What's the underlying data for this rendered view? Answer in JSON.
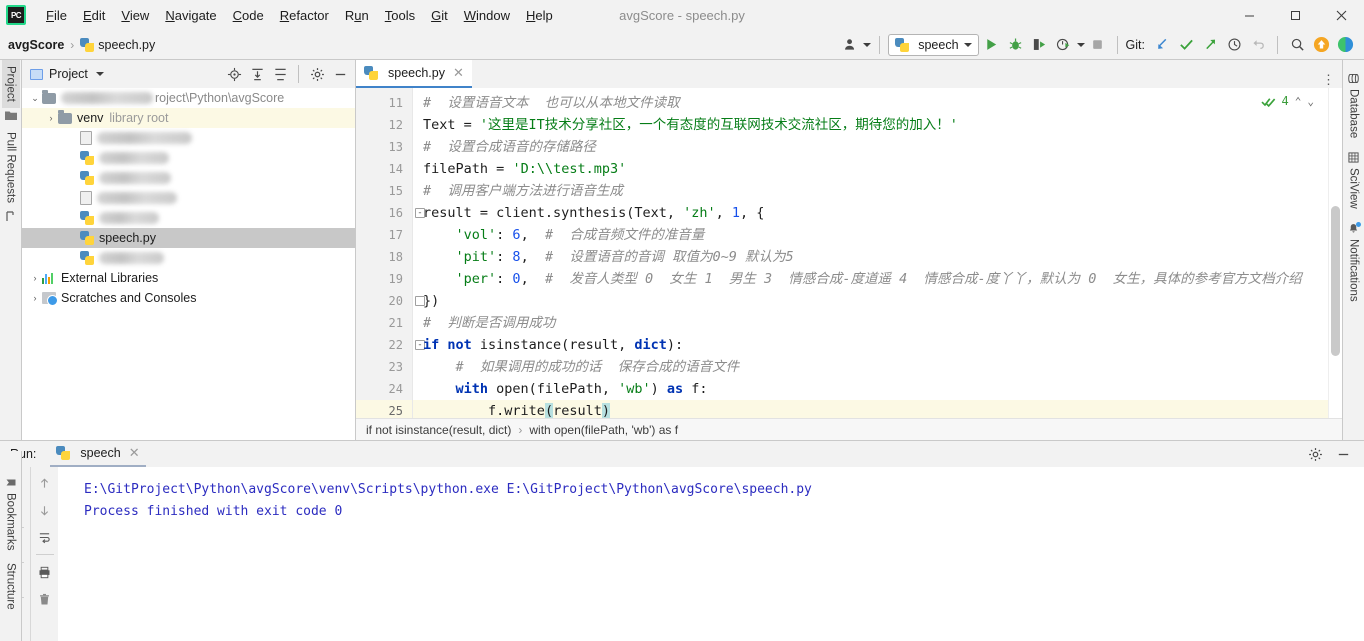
{
  "window": {
    "title": "avgScore - speech.py",
    "logo_text": "PC",
    "minimize": "—",
    "maximize": "❐",
    "close": "✕"
  },
  "menu": [
    {
      "label": "File",
      "mnemonic": "F"
    },
    {
      "label": "Edit",
      "mnemonic": "E"
    },
    {
      "label": "View",
      "mnemonic": "V"
    },
    {
      "label": "Navigate",
      "mnemonic": "N"
    },
    {
      "label": "Code",
      "mnemonic": "C"
    },
    {
      "label": "Refactor",
      "mnemonic": "R"
    },
    {
      "label": "Run",
      "mnemonic": "u"
    },
    {
      "label": "Tools",
      "mnemonic": "T"
    },
    {
      "label": "Git",
      "mnemonic": "G"
    },
    {
      "label": "Window",
      "mnemonic": "W"
    },
    {
      "label": "Help",
      "mnemonic": "H"
    }
  ],
  "navbar": {
    "project": "avgScore",
    "separator": "›",
    "file": "speech.py",
    "run_config": "speech",
    "git_label": "Git:",
    "icons": {
      "user_avatar": "user-avatar-icon",
      "run": "run-icon",
      "debug": "debug-icon",
      "coverage": "run-with-coverage-icon",
      "profile": "profile-icon",
      "stop": "stop-icon",
      "update_project": "update-project-icon",
      "commit": "commit-icon",
      "push": "push-icon",
      "history": "history-icon",
      "rollback": "rollback-icon",
      "search_everywhere": "search-icon",
      "notification_badge": "update-badge-icon",
      "ide_feature": "ide-feature-icon"
    }
  },
  "left_strip": [
    {
      "label": "Project",
      "selected": true
    },
    {
      "label": "Pull Requests",
      "selected": false
    }
  ],
  "left_strip_bottom": [
    {
      "label": "Bookmarks"
    },
    {
      "label": "Structure"
    }
  ],
  "right_strip": [
    {
      "label": "Database",
      "icon": "database-icon"
    },
    {
      "label": "SciView",
      "icon": "sciview-icon"
    },
    {
      "label": "Notifications",
      "icon": "notifications-icon"
    }
  ],
  "project_pane": {
    "title": "Project",
    "toolbar": [
      "locate-icon",
      "expand-all-icon",
      "collapse-all-icon",
      "settings-icon",
      "hide-icon"
    ],
    "tree": [
      {
        "kind": "root",
        "arrow": "⌄",
        "label_blurred": true,
        "path_suffix": "roject\\Python\\avgScore",
        "indent": 0,
        "selected": "none"
      },
      {
        "kind": "folder",
        "arrow": "›",
        "label": "venv",
        "tag": "library root",
        "indent": 1,
        "selected": "yellow"
      },
      {
        "kind": "doc",
        "label_blurred": true,
        "blur_width": 95,
        "indent": 2,
        "selected": "none"
      },
      {
        "kind": "py",
        "label_blurred": true,
        "blur_width": 70,
        "indent": 2,
        "selected": "none"
      },
      {
        "kind": "py",
        "label_blurred": true,
        "blur_width": 72,
        "indent": 2,
        "selected": "none"
      },
      {
        "kind": "doc",
        "label_blurred": true,
        "blur_width": 80,
        "indent": 2,
        "selected": "none"
      },
      {
        "kind": "py",
        "label_blurred": true,
        "blur_width": 60,
        "indent": 2,
        "selected": "none"
      },
      {
        "kind": "py",
        "label": "speech.py",
        "indent": 2,
        "selected": "grey"
      },
      {
        "kind": "py",
        "label_blurred": true,
        "blur_width": 65,
        "indent": 2,
        "selected": "none"
      },
      {
        "kind": "extlib",
        "arrow": "›",
        "label": "External Libraries",
        "indent": 0,
        "selected": "none"
      },
      {
        "kind": "scratch",
        "arrow": "›",
        "label": "Scratches and Consoles",
        "indent": 0,
        "selected": "none"
      }
    ]
  },
  "editor": {
    "tab": {
      "label": "speech.py",
      "close": "✕"
    },
    "options_glyph": "⋮",
    "inspection": {
      "count": "4",
      "icon": "inspection-ok-icon",
      "up": "⌃",
      "down": "⌄"
    },
    "first_line_number": 11,
    "current_line": 25,
    "lines": [
      {
        "n": 11,
        "fold": null
      },
      {
        "n": 12,
        "fold": null
      },
      {
        "n": 13,
        "fold": null
      },
      {
        "n": 14,
        "fold": null
      },
      {
        "n": 15,
        "fold": null
      },
      {
        "n": 16,
        "fold": "minus"
      },
      {
        "n": 17,
        "fold": null
      },
      {
        "n": 18,
        "fold": null
      },
      {
        "n": 19,
        "fold": null
      },
      {
        "n": 20,
        "fold": "end"
      },
      {
        "n": 21,
        "fold": null
      },
      {
        "n": 22,
        "fold": "minus"
      },
      {
        "n": 23,
        "fold": null
      },
      {
        "n": 24,
        "fold": null
      },
      {
        "n": 25,
        "fold": "end"
      }
    ],
    "code_text": [
      "#  设置语音文本  也可以从本地文件读取",
      "Text = '这里是IT技术分享社区，一个有态度的互联网技术交流社区，期待您的加入！'",
      "#  设置合成语音的存储路径",
      "filePath = 'D:\\\\test.mp3'",
      "#  调用客户端方法进行语音生成",
      "result = client.synthesis(Text, 'zh', 1, {",
      "    'vol': 6,  #  合成音频文件的准音量",
      "    'pit': 8,  #  设置语音的音调 取值为0~9 默认为5",
      "    'per': 0,  #  发音人类型 0  女生 1  男生 3  情感合成-度道遥 4  情感合成-度丫丫，默认为 0  女生，具体的参考官方文档介绍",
      "})",
      "#  判断是否调用成功",
      "if not isinstance(result, dict):",
      "    #  如果调用的成功的话  保存合成的语音文件",
      "    with open(filePath, 'wb') as f:",
      "        f.write(result)"
    ]
  },
  "breadcrumbs": {
    "item1": "if not isinstance(result, dict)",
    "separator": "›",
    "item2": "with open(filePath, 'wb') as f"
  },
  "run_panel": {
    "label": "Run:",
    "tab": "speech",
    "tab_close": "✕",
    "settings_icon": "settings-icon",
    "hide_icon": "hide-icon",
    "tools": [
      "rerun-icon",
      "settings-wrench-icon",
      "stop-icon",
      "layout-icon",
      "pin-icon"
    ],
    "tools2": [
      "scroll-up-icon",
      "scroll-down-icon",
      "soft-wrap-icon",
      "print-icon",
      "clear-all-icon"
    ],
    "console_lines": [
      "E:\\GitProject\\Python\\avgScore\\venv\\Scripts\\python.exe E:\\GitProject\\Python\\avgScore\\speech.py",
      "",
      "Process finished with exit code 0"
    ]
  },
  "colors": {
    "accent_blue": "#4083c9",
    "keyword": "#0033b3",
    "string": "#067d17",
    "number": "#1750eb",
    "comment": "#8c8c8c",
    "console": "#2c2cc0",
    "selection_highlight": "#b7e0e0",
    "current_line": "#fcf9e4",
    "chrome": "#f2f2f2"
  }
}
